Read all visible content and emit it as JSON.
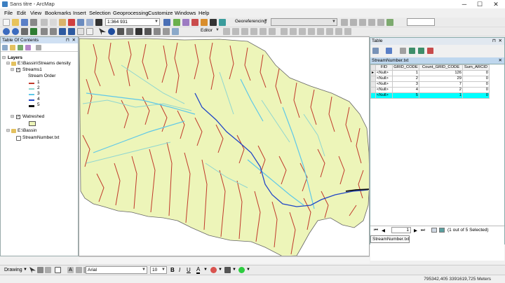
{
  "window": {
    "title": "Sans titre - ArcMap",
    "minimize": "─",
    "maximize": "☐",
    "close": "✕"
  },
  "menu": [
    "File",
    "Edit",
    "View",
    "Bookmarks",
    "Insert",
    "Selection",
    "Geoprocessing",
    "Customize",
    "Windows",
    "Help"
  ],
  "toolbar": {
    "scale": "1:364 931",
    "georeferencing_label": "Georeferencing",
    "editor_label": "Editor"
  },
  "toc": {
    "title": "Table Of Contents",
    "layers_label": "Layers",
    "group1": "E:\\Bassin\\Streams density",
    "streams_layer": "Streams1",
    "stream_order_label": "Stream Order",
    "legend": [
      {
        "label": "1",
        "color": "#c0392b"
      },
      {
        "label": "2",
        "color": "#8fd6d0"
      },
      {
        "label": "3",
        "color": "#5ec8e8"
      },
      {
        "label": "4",
        "color": "#2146c7"
      },
      {
        "label": "5",
        "color": "#111111"
      }
    ],
    "watershed_layer": "Watreshed",
    "watershed_color": "#edf5b9",
    "group2": "E:\\Bassin",
    "table_item": "StreamNumber.txt"
  },
  "table": {
    "window_title": "Table",
    "tab_label": "StreamNumber.txt",
    "columns": [
      "FID",
      "GRID_CODE",
      "Count_GRID_CODE",
      "Sum_ARCID"
    ],
    "rows": [
      [
        "<Null>",
        "1",
        "126",
        "0"
      ],
      [
        "<Null>",
        "2",
        "29",
        "0"
      ],
      [
        "<Null>",
        "3",
        "7",
        "0"
      ],
      [
        "<Null>",
        "4",
        "2",
        "0"
      ],
      [
        "<Null>",
        "5",
        "1",
        "0"
      ]
    ],
    "selected_row": 4,
    "current_record": "1",
    "selection_status": "(1 out of 5 Selected)",
    "bottom_tab": "StreamNumber.txt"
  },
  "drawing": {
    "label": "Drawing",
    "font": "Arial",
    "font_size": "10",
    "bold": "B",
    "italic": "I",
    "underline": "U"
  },
  "status": {
    "coordinates": "795342,405  3391619,725 Meters"
  }
}
